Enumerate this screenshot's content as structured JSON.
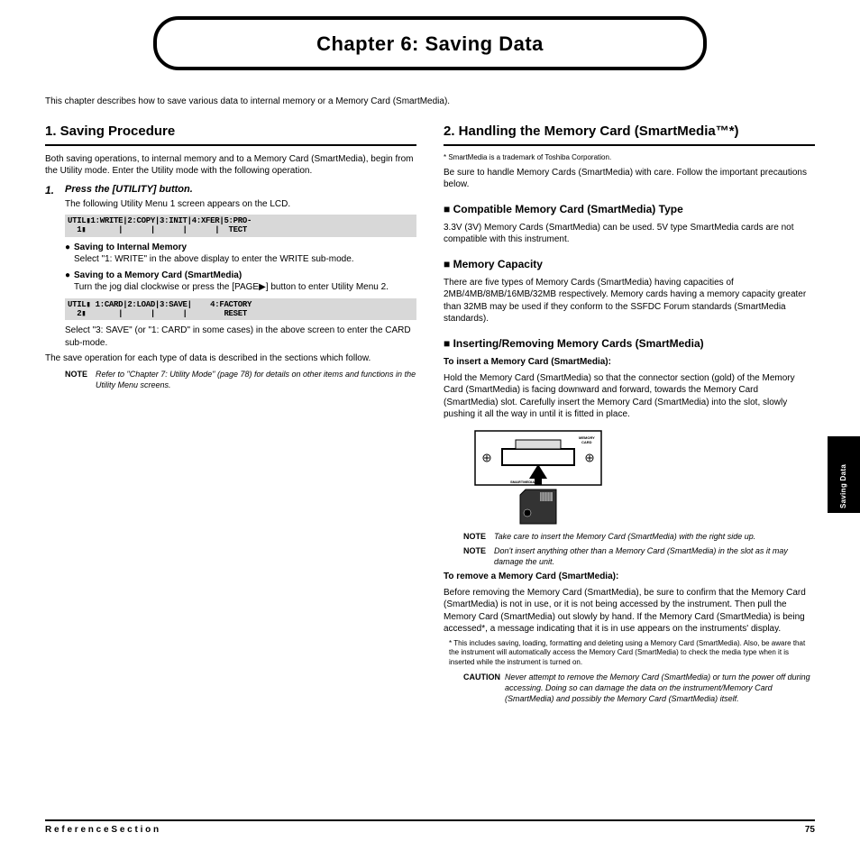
{
  "title": "Chapter 6: Saving Data",
  "intro": "This chapter describes how to save various data to internal memory or a Memory Card (SmartMedia).",
  "left": {
    "h2": "1. Saving Procedure",
    "p1": "Both saving operations, to internal memory and to a Memory Card (SmartMedia), begin from the Utility mode. Enter the Utility mode with the following operation.",
    "step1_lead": "Press the [UTILITY] button.",
    "step1_detail": "The following Utility Menu 1 screen appears on the LCD.",
    "lcd1_l1": "UTIL▮1:WRITE|2:COPY|3:INIT|4:XFER|5:PRO-",
    "lcd1_l2": "  1▮       |      |      |      |  TECT",
    "b1_label": "Saving to Internal Memory",
    "b1_text": "Select \"1: WRITE\" in the above display to enter the WRITE sub-mode.",
    "b2_label": "Saving to a Memory Card (SmartMedia)",
    "b2_text": "Turn the jog dial clockwise or press the [PAGE▶] button to enter Utility Menu 2.",
    "lcd2_l1": "UTIL▮ 1:CARD|2:LOAD|3:SAVE|    4:FACTORY",
    "lcd2_l2": "  2▮       |      |      |        RESET",
    "p2": "Select \"3: SAVE\" (or \"1: CARD\" in some cases) in the above screen to enter the CARD sub-mode.",
    "p3": "The save operation for each type of data is described in the sections which follow.",
    "note_text": "Refer to \"Chapter 7: Utility Mode\" (page 78) for details on other items and functions in the Utility Menu screens."
  },
  "right": {
    "h2": "2. Handling the Memory Card (SmartMedia™*)",
    "sm_footnote": "* SmartMedia is a trademark of Toshiba Corporation.",
    "p1": "Be sure to handle Memory Cards (SmartMedia) with care. Follow the important precautions below.",
    "h3a": "■ Compatible Memory Card (SmartMedia) Type",
    "p2": "3.3V (3V) Memory Cards (SmartMedia) can be used. 5V type SmartMedia cards are not compatible with this instrument.",
    "h3b": "■ Memory Capacity",
    "p3": "There are five types of Memory Cards (SmartMedia) having capacities of 2MB/4MB/8MB/16MB/32MB respectively. Memory cards having a memory capacity greater than 32MB may be used if they conform to the SSFDC Forum standards (SmartMedia standards).",
    "h3c": "■ Inserting/Removing Memory Cards (SmartMedia)",
    "ins_head": "To insert a Memory Card (SmartMedia):",
    "ins_body": "Hold the Memory Card (SmartMedia) so that the connector section (gold) of the Memory Card (SmartMedia) is facing downward and forward, towards the Memory Card (SmartMedia) slot. Carefully insert the Memory Card (SmartMedia) into the slot, slowly pushing it all the way in until it is fitted in place.",
    "illus_badge": "MEMORY\nCARD",
    "illus_label": "SMARTMEDIA™",
    "note1": "Take care to insert the Memory Card (SmartMedia) with the right side up.",
    "note2": "Don't insert anything other than a Memory Card (SmartMedia) in the slot as it may damage the unit.",
    "rem_head": "To remove a Memory Card (SmartMedia):",
    "rem_body": "Before removing the Memory Card (SmartMedia), be sure to confirm that the Memory Card (SmartMedia) is not in use, or it is not being accessed by the instrument. Then pull the Memory Card (SmartMedia) out slowly by hand. If the Memory Card (SmartMedia) is being accessed*, a message indicating that it is in use appears on the instruments' display.",
    "rem_foot": "* This includes saving, loading, formatting and deleting using a Memory Card (SmartMedia). Also, be aware that the instrument will automatically access the Memory Card (SmartMedia) to check the media type when it is inserted while the instrument is turned on.",
    "caution_head": "CAUTION",
    "caution_body": "Never attempt to remove the Memory Card (SmartMedia) or turn the power off during accessing. Doing so can damage the data on the instrument/Memory Card (SmartMedia) and possibly the Memory Card (SmartMedia) itself."
  },
  "tab_text": "Saving Data",
  "footer_left": "R e f e r e n c e   S e c t i o n",
  "footer_right": "75"
}
